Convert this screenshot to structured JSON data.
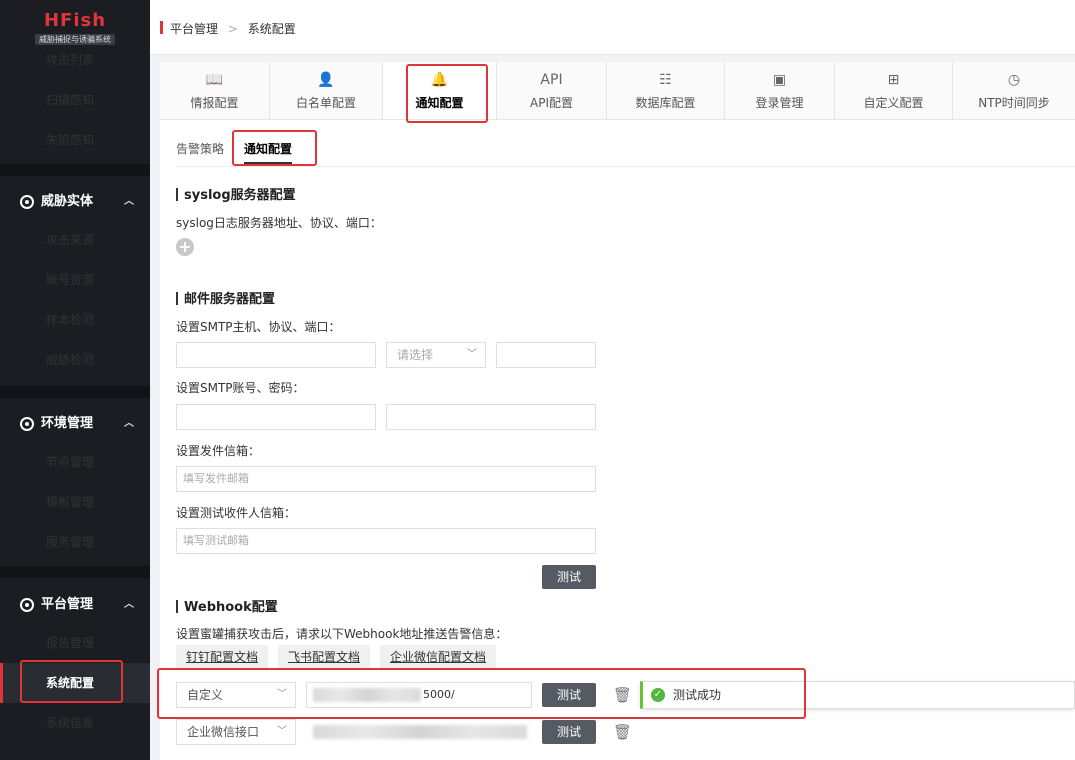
{
  "brand": {
    "logo": "HFish",
    "tagline": "威胁捕捉与诱骗系统"
  },
  "sidebar": {
    "items_top": [
      {
        "label": "攻击列表"
      },
      {
        "label": "扫描感知"
      },
      {
        "label": "失陷感知"
      }
    ],
    "groups": [
      {
        "label": "威胁实体",
        "chevron": "chevron-up-icon",
        "items": [
          "攻击来源",
          "账号资源",
          "样本检测",
          "威胁检测"
        ]
      },
      {
        "label": "环境管理",
        "chevron": "chevron-up-icon",
        "items": [
          "节点管理",
          "模板管理",
          "服务管理"
        ]
      },
      {
        "label": "平台管理",
        "chevron": "chevron-up-icon",
        "items": [
          "报告管理",
          "系统配置",
          "系统信息"
        ]
      }
    ],
    "active_item": "系统配置"
  },
  "breadcrumb": {
    "parent": "平台管理",
    "separator": ">",
    "current": "系统配置"
  },
  "tabs": [
    {
      "label": "情报配置",
      "icon": "book-icon",
      "glyph": "📖"
    },
    {
      "label": "白名单配置",
      "icon": "user-icon",
      "glyph": "👤"
    },
    {
      "label": "通知配置",
      "icon": "bell-icon",
      "glyph": "🔔"
    },
    {
      "label": "API配置",
      "icon": "api-icon",
      "glyph": "API"
    },
    {
      "label": "数据库配置",
      "icon": "database-icon",
      "glyph": "☷"
    },
    {
      "label": "登录管理",
      "icon": "login-icon",
      "glyph": "▣"
    },
    {
      "label": "自定义配置",
      "icon": "grid-icon",
      "glyph": "⊞"
    },
    {
      "label": "NTP时间同步",
      "icon": "clock-icon",
      "glyph": "◷"
    }
  ],
  "active_tab": "通知配置",
  "subtabs": [
    {
      "label": "告警策略"
    },
    {
      "label": "通知配置"
    }
  ],
  "active_subtab": "通知配置",
  "syslog": {
    "title": "syslog服务器配置",
    "label": "syslog日志服务器地址、协议、端口：",
    "add_icon": "plus-circle-icon"
  },
  "mail": {
    "title": "邮件服务器配置",
    "smtp_host_label": "设置SMTP主机、协议、端口：",
    "protocol_placeholder": "请选择",
    "smtp_account_label": "设置SMTP账号、密码：",
    "sender_label": "设置发件信箱：",
    "sender_placeholder": "填写发件邮箱",
    "test_recipient_label": "设置测试收件人信箱：",
    "test_recipient_placeholder": "填写测试邮箱",
    "test_button": "测试"
  },
  "webhook": {
    "title": "Webhook配置",
    "description": "设置蜜罐捕获攻击后，请求以下Webhook地址推送告警信息：",
    "doc_links": [
      "钉钉配置文档",
      "飞书配置文档",
      "企业微信配置文档"
    ],
    "rows": [
      {
        "type": "自定义",
        "url_suffix": "5000/",
        "test_button": "测试"
      },
      {
        "type": "企业微信接口",
        "url_suffix": "",
        "test_button": "测试"
      }
    ],
    "toast": "测试成功"
  },
  "colors": {
    "accent": "#e0353b",
    "sidebar_bg": "#1b1d22",
    "button": "#555a63",
    "success": "#52b73a"
  }
}
